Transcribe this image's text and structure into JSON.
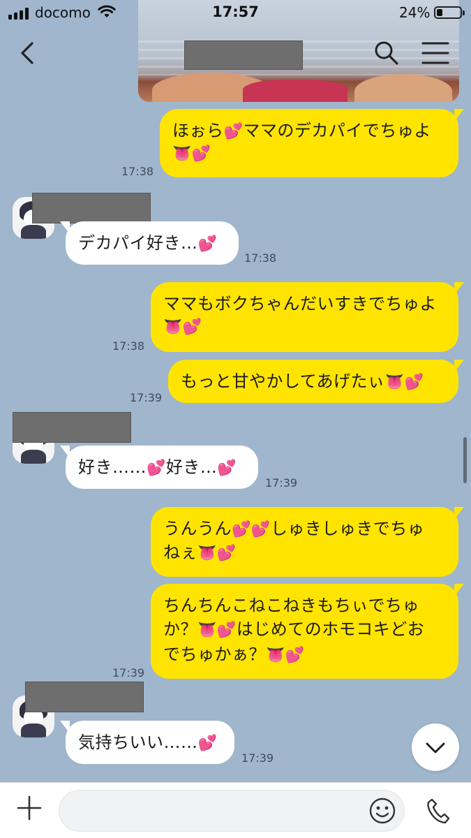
{
  "status_bar": {
    "carrier": "docomo",
    "time": "17:57",
    "battery": "24%"
  },
  "header": {
    "back_icon": "chevron-left-icon",
    "search_icon": "search-icon",
    "menu_icon": "menu-icon"
  },
  "messages": [
    {
      "sender": "me",
      "parts": [
        "ほぉら",
        "💕",
        "ママのデカパイでちゅよ"
      ],
      "line2": [
        "👅",
        "💕"
      ],
      "time": "17:38"
    },
    {
      "sender": "them",
      "parts": [
        "デカパイ好き…",
        "💕"
      ],
      "time": "17:38"
    },
    {
      "sender": "me",
      "parts": [
        "ママもボクちゃんだいすきでちゅよ"
      ],
      "line2": [
        "👅",
        "💕"
      ],
      "time": "17:38"
    },
    {
      "sender": "me",
      "parts": [
        "もっと甘やかしてあげたぃ",
        "👅",
        "💕"
      ],
      "time": "17:39"
    },
    {
      "sender": "them",
      "parts": [
        "好き……",
        "💕",
        "好き…",
        "💕"
      ],
      "time": "17:39"
    },
    {
      "sender": "me",
      "parts": [
        "うんうん",
        "💕",
        "💕",
        "しゅきしゅきでちゅ"
      ],
      "line2": [
        "ねぇ",
        "👅",
        "💕"
      ],
      "time": ""
    },
    {
      "sender": "me",
      "parts": [
        "ちんちんこねこねきもちぃでちゅ"
      ],
      "line2": [
        "か？",
        "👅",
        "💕",
        "はじめてのホモコキどお"
      ],
      "line3": [
        "でちゅかぁ？",
        "👅",
        "💕"
      ],
      "time": "17:39"
    },
    {
      "sender": "them",
      "parts": [
        "気持ちいい……",
        "💕"
      ],
      "time": "17:39"
    }
  ],
  "input": {
    "placeholder": "",
    "plus_icon": "plus-icon",
    "emoji_icon": "emoji-icon",
    "call_icon": "phone-icon"
  },
  "scroll_down_icon": "chevron-down-icon",
  "colors": {
    "chat_bg": "#9fb6cd",
    "my_bubble": "#ffe400",
    "their_bubble": "#ffffff"
  }
}
